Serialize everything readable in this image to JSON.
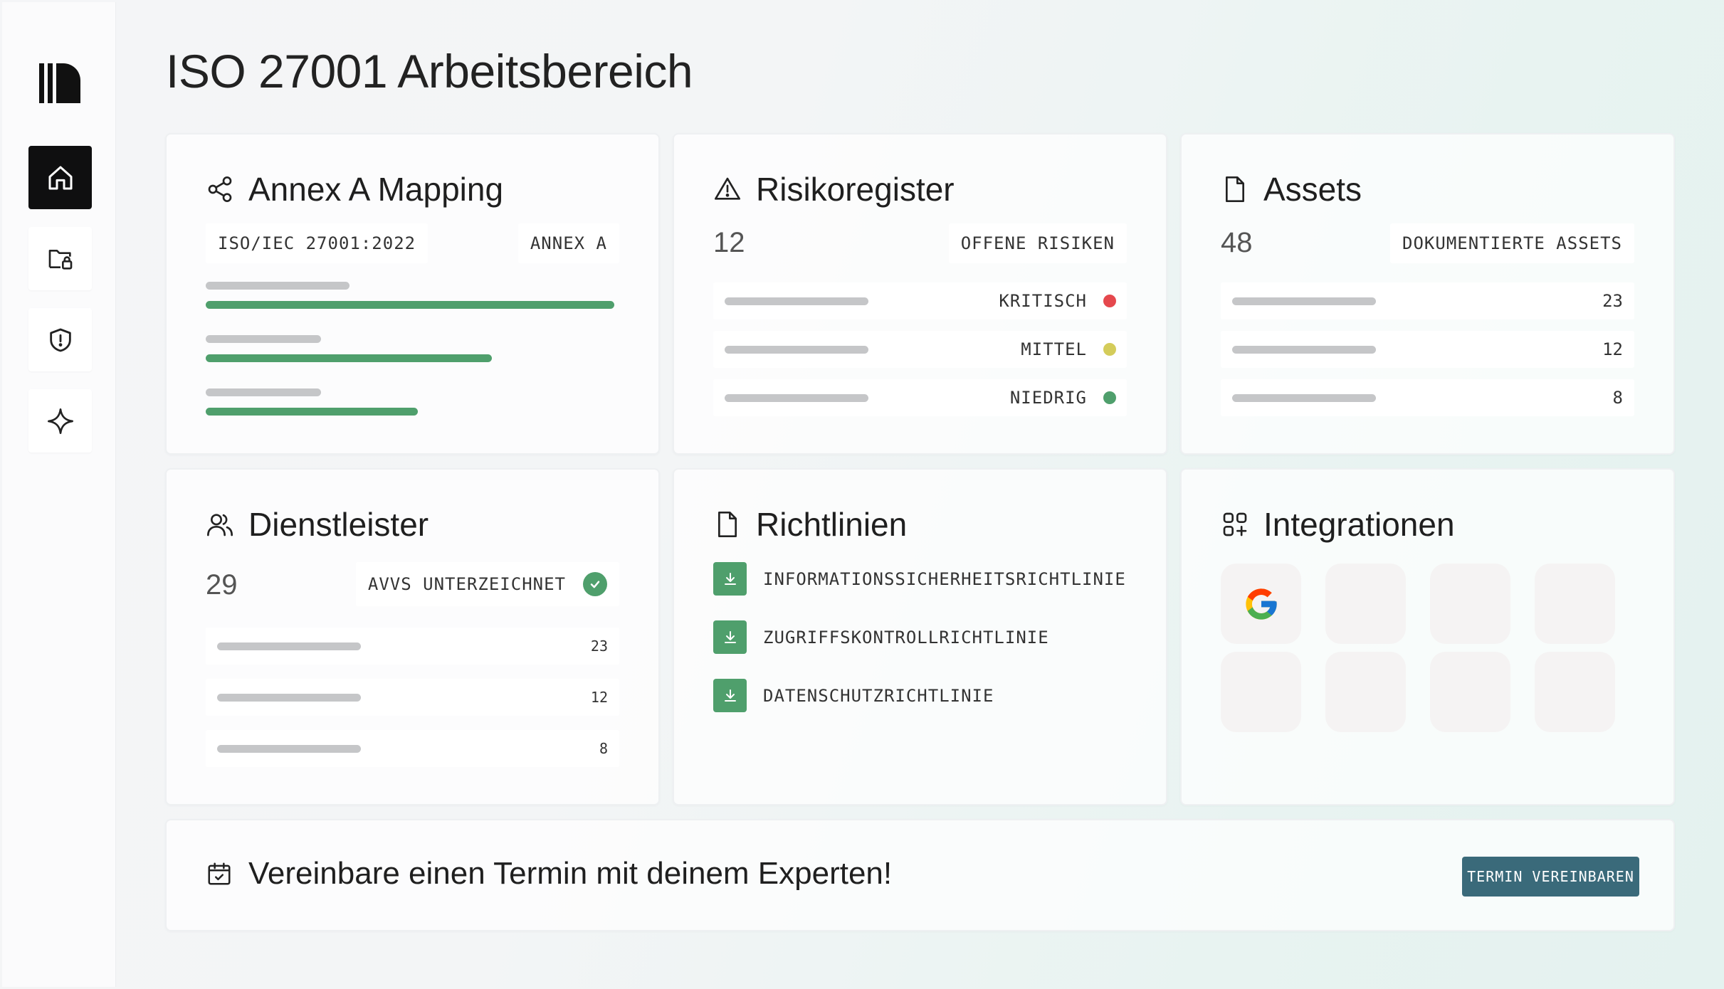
{
  "page_title": "ISO 27001 Arbeitsbereich",
  "sidebar": {
    "items": [
      {
        "name": "home",
        "icon": "home-icon",
        "active": true
      },
      {
        "name": "folder-lock",
        "icon": "folder-lock-icon",
        "active": false
      },
      {
        "name": "shield",
        "icon": "shield-alert-icon",
        "active": false
      },
      {
        "name": "sparkle",
        "icon": "sparkle-icon",
        "active": false
      }
    ]
  },
  "annex": {
    "title": "Annex A Mapping",
    "icon": "share-nodes-icon",
    "tag_left": "ISO/IEC 27001:2022",
    "tag_right": "ANNEX A",
    "progress": [
      1.0,
      0.7,
      0.52
    ]
  },
  "risks": {
    "title": "Risikoregister",
    "icon": "warning-triangle-icon",
    "count": "12",
    "tag": "OFFENE RISIKEN",
    "levels": [
      {
        "label": "KRITISCH",
        "color": "#e5484d"
      },
      {
        "label": "MITTEL",
        "color": "#d4cc5a"
      },
      {
        "label": "NIEDRIG",
        "color": "#4f9f6c"
      }
    ]
  },
  "assets": {
    "title": "Assets",
    "icon": "document-icon",
    "count": "48",
    "tag": "DOKUMENTIERTE ASSETS",
    "rows": [
      "23",
      "12",
      "8"
    ]
  },
  "providers": {
    "title": "Dienstleister",
    "icon": "users-icon",
    "count": "29",
    "tag": "AVVS UNTERZEICHNET",
    "rows": [
      "23",
      "12",
      "8"
    ]
  },
  "policies": {
    "title": "Richtlinien",
    "icon": "document-icon",
    "items": [
      "INFORMATIONSSICHERHEITSRICHTLINIE",
      "ZUGRIFFSKONTROLLRICHTLINIE",
      "DATENSCHUTZRICHTLINIE"
    ]
  },
  "integrations": {
    "title": "Integrationen",
    "icon": "apps-add-icon",
    "tiles": [
      "google-icon",
      "",
      "",
      "",
      "",
      "",
      "",
      ""
    ]
  },
  "cta": {
    "text": "Vereinbare einen Termin mit deinem Experten!",
    "icon": "calendar-check-icon",
    "button": "TERMIN VEREINBAREN"
  },
  "colors": {
    "accent_green": "#4f9f6c",
    "button": "#3a6a7a",
    "critical": "#e5484d",
    "medium": "#d4cc5a",
    "low": "#4f9f6c"
  }
}
